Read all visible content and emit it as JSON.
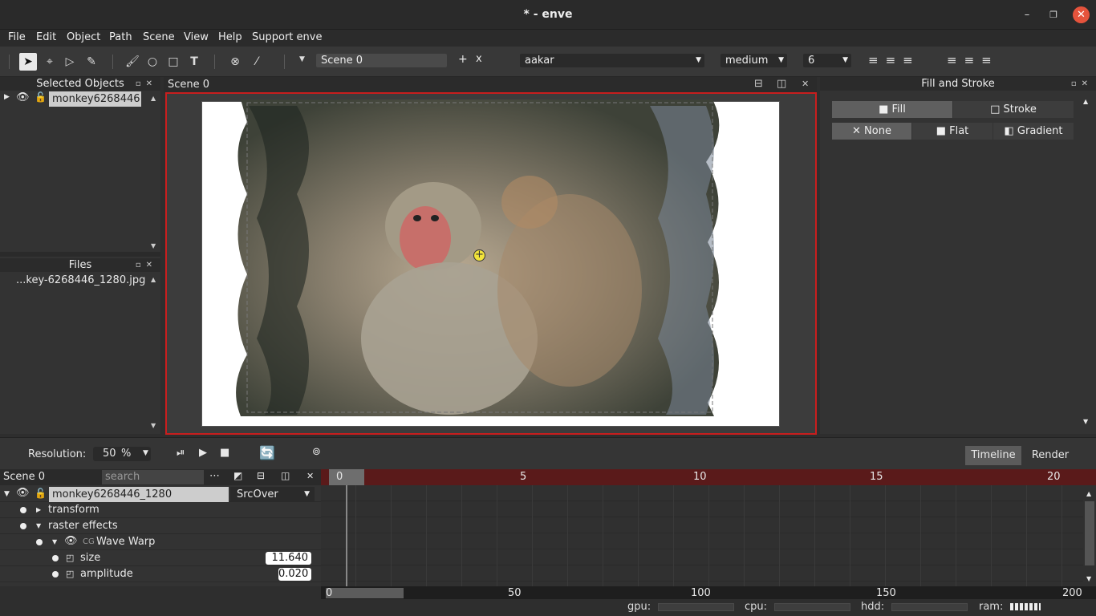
{
  "window": {
    "title": "* - enve"
  },
  "menu": [
    "File",
    "Edit",
    "Object",
    "Path",
    "Scene",
    "View",
    "Help",
    "Support enve"
  ],
  "toolbar": {
    "scene_name": "Scene 0",
    "add": "+",
    "remove": "x",
    "font": "aakar",
    "weight": "medium",
    "size": "6"
  },
  "selected_objects": {
    "title": "Selected Objects",
    "items": [
      "monkey6268446"
    ]
  },
  "files": {
    "title": "Files",
    "items": [
      "...key-6268446_1280.jpg"
    ]
  },
  "canvas": {
    "tab": "Scene 0"
  },
  "fill_stroke": {
    "title": "Fill and Stroke",
    "tabs": [
      "Fill",
      "Stroke"
    ],
    "modes": [
      "None",
      "Flat",
      "Gradient"
    ]
  },
  "bottom": {
    "resolution_label": "Resolution:",
    "resolution_value": "50",
    "resolution_unit": "%",
    "tabs": [
      "Timeline",
      "Render"
    ]
  },
  "layers": {
    "scene": "Scene 0",
    "search_placeholder": "search",
    "layer_name": "monkey6268446_1280",
    "blend": "SrcOver",
    "rows": {
      "transform": "transform",
      "raster": "raster effects",
      "wave": "Wave Warp",
      "size": "size",
      "amplitude": "amplitude"
    },
    "size_value": "11.640",
    "amplitude_value": "0.020"
  },
  "timeline": {
    "current_frame": "0",
    "ruler": [
      "5",
      "10",
      "15",
      "20"
    ],
    "bottom_ruler": [
      "0",
      "50",
      "100",
      "150",
      "200"
    ]
  },
  "status": {
    "gpu": "gpu:",
    "cpu": "cpu:",
    "hdd": "hdd:",
    "ram": "ram:"
  }
}
